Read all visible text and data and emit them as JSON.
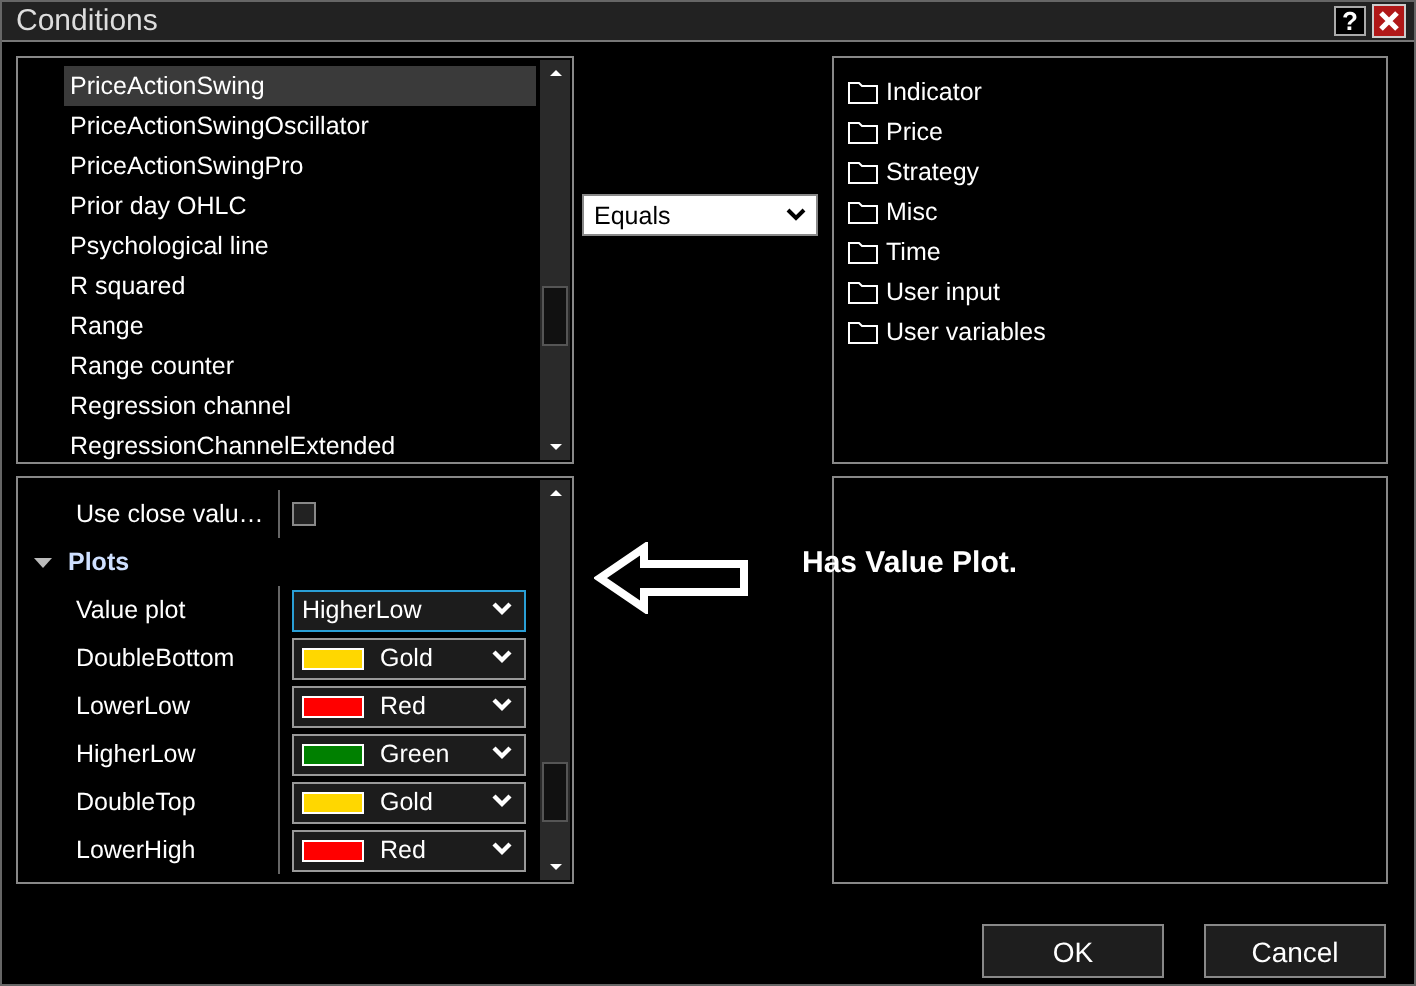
{
  "window": {
    "title": "Conditions",
    "help": "?"
  },
  "indicators": {
    "items": [
      {
        "label": "PriceActionSwing",
        "selected": true
      },
      {
        "label": "PriceActionSwingOscillator",
        "selected": false
      },
      {
        "label": "PriceActionSwingPro",
        "selected": false
      },
      {
        "label": "Prior day OHLC",
        "selected": false
      },
      {
        "label": "Psychological line",
        "selected": false
      },
      {
        "label": "R squared",
        "selected": false
      },
      {
        "label": "Range",
        "selected": false
      },
      {
        "label": "Range counter",
        "selected": false
      },
      {
        "label": "Regression channel",
        "selected": false
      },
      {
        "label": "RegressionChannelExtended",
        "selected": false
      }
    ]
  },
  "operator": {
    "value": "Equals"
  },
  "categories": [
    {
      "label": "Indicator"
    },
    {
      "label": "Price"
    },
    {
      "label": "Strategy"
    },
    {
      "label": "Misc"
    },
    {
      "label": "Time"
    },
    {
      "label": "User input"
    },
    {
      "label": "User variables"
    }
  ],
  "properties": {
    "rows": [
      {
        "kind": "checkbox",
        "label": "Use close valu…",
        "checked": false
      },
      {
        "kind": "group",
        "label": "Plots",
        "expanded": true
      },
      {
        "kind": "select",
        "label": "Value plot",
        "value": "HigherLow",
        "focused": true
      },
      {
        "kind": "color",
        "label": "DoubleBottom",
        "value": "Gold",
        "color": "#ffd700"
      },
      {
        "kind": "color",
        "label": "LowerLow",
        "value": "Red",
        "color": "#ff0000"
      },
      {
        "kind": "color",
        "label": "HigherLow",
        "value": "Green",
        "color": "#008000"
      },
      {
        "kind": "color",
        "label": "DoubleTop",
        "value": "Gold",
        "color": "#ffd700"
      },
      {
        "kind": "color",
        "label": "LowerHigh",
        "value": "Red",
        "color": "#ff0000"
      }
    ]
  },
  "annotation": {
    "text": "Has Value Plot."
  },
  "buttons": [
    {
      "label": "OK"
    },
    {
      "label": "Cancel"
    }
  ]
}
